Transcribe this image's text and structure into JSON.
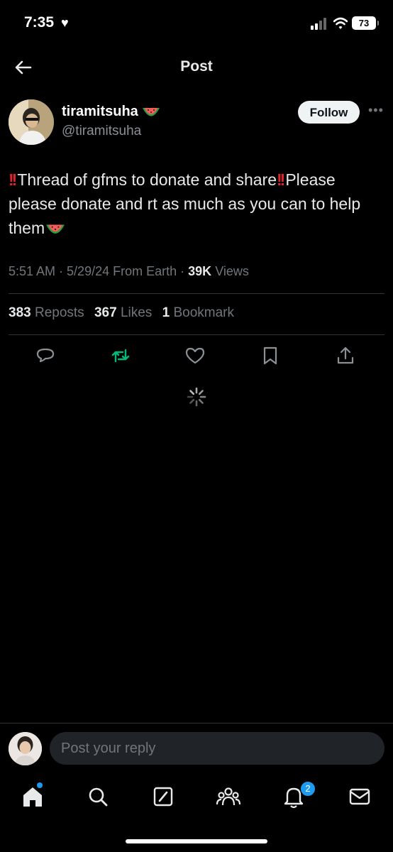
{
  "status_bar": {
    "time": "7:35",
    "battery": "73"
  },
  "header": {
    "title": "Post"
  },
  "author": {
    "name": "tiramitsuha",
    "handle": "@tiramitsuha",
    "follow_label": "Follow"
  },
  "post": {
    "part1": "Thread of gfms to donate and share",
    "part2": "Please please donate and rt as much as you can to help them",
    "time": "5:51 AM",
    "date": "5/29/24",
    "location": "From Earth",
    "views_count": "39K",
    "views_label": "Views"
  },
  "stats": {
    "reposts_count": "383",
    "reposts_label": "Reposts",
    "likes_count": "367",
    "likes_label": "Likes",
    "bookmarks_count": "1",
    "bookmarks_label": "Bookmark"
  },
  "actions": [
    "reply-icon",
    "repost-icon",
    "like-icon",
    "bookmark-icon",
    "share-icon"
  ],
  "reply": {
    "placeholder": "Post your reply"
  },
  "tabbar": {
    "items": [
      "home-icon",
      "search-icon",
      "grok-icon",
      "communities-icon",
      "notifications-icon",
      "messages-icon"
    ],
    "notifications_badge": "2"
  },
  "colors": {
    "accent": "#1d9bf0",
    "repost_active": "#00ba7c",
    "alert_red": "#e0232d",
    "background": "#000000"
  }
}
